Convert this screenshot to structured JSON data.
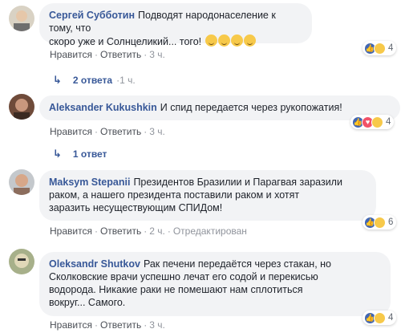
{
  "comments": [
    {
      "author": "Сергей Субботин",
      "text_line1": "Подводят народонаселение к тому, что",
      "text_line2": "скоро уже и Солнцеликий... того!",
      "emojis": [
        "thinking-face",
        "grinning-face",
        "grimacing-face",
        "astonished-face"
      ],
      "like": "Нравится",
      "reply": "Ответить",
      "time": "3 ч.",
      "reaction_count": "4",
      "reactions": [
        "like",
        "wow"
      ],
      "replies_label": "2 ответа",
      "replies_time": "1 ч."
    },
    {
      "author": "Aleksander Kukushkin",
      "text_line1": "И спид передается через рукопожатия!",
      "like": "Нравится",
      "reply": "Ответить",
      "time": "3 ч.",
      "reaction_count": "4",
      "reactions": [
        "like",
        "love",
        "haha"
      ],
      "replies_label": "1 ответ"
    },
    {
      "author": "Maksym Stepanii",
      "text_line1": "Президентов Бразилии и Парагвая заразили",
      "text_line2": "раком, а нашего президента поставили раком и хотят",
      "text_line3": "заразить несуществующим СПИДом!",
      "like": "Нравится",
      "reply": "Ответить",
      "time": "2 ч.",
      "edited": "Отредактирован",
      "reaction_count": "6",
      "reactions": [
        "like",
        "haha"
      ]
    },
    {
      "author": "Oleksandr Shutkov",
      "text_line1": "Рак печени передаётся через стакан, но",
      "text_line2": "Сколковские врачи успешно лечат его содой и перекисью",
      "text_line3": "водорода. Никакие раки не помешают нам сплотиться",
      "text_line4": "вокруг... Самого.",
      "like": "Нравится",
      "reply": "Ответить",
      "time": "3 ч.",
      "reaction_count": "4",
      "reactions": [
        "like",
        "haha"
      ]
    }
  ],
  "colors": {
    "author": "#385898",
    "bubble": "#f2f3f5",
    "like": "#4267b2",
    "love": "#f25268",
    "haha": "#f7c94a",
    "muted": "#90949c"
  }
}
